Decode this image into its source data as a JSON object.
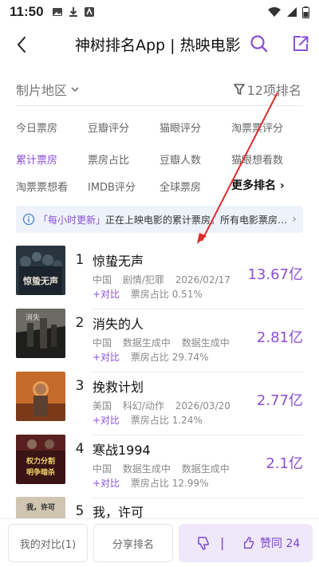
{
  "status_bar": {
    "time": "11:50"
  },
  "header": {
    "title": "神树排名App | 热映电影"
  },
  "filters": {
    "region": "制片地区",
    "rank_count": "12项排名"
  },
  "tabs": [
    {
      "label": "今日票房"
    },
    {
      "label": "豆瓣评分"
    },
    {
      "label": "猫眼评分"
    },
    {
      "label": "淘票票评分"
    },
    {
      "label": "累计票房",
      "active": true
    },
    {
      "label": "票房占比"
    },
    {
      "label": "豆瓣人数"
    },
    {
      "label": "猫眼想看数"
    },
    {
      "label": "淘票票想看"
    },
    {
      "label": "IMDB评分"
    },
    {
      "label": "全球票房"
    },
    {
      "label": "更多排名"
    }
  ],
  "notice": {
    "highlight": "「每小时更新」",
    "text": "正在上映电影的累计票房。所有电影票房…"
  },
  "movies": [
    {
      "rank": "1",
      "title": "惊蛰无声",
      "country": "中国",
      "genre": "剧情/犯罪",
      "date": "2026/02/17",
      "compare": "+对比",
      "share_label": "票房占比",
      "share": "0.51%",
      "value": "13.67亿"
    },
    {
      "rank": "2",
      "title": "消失的人",
      "country": "中国",
      "genre": "数据生成中",
      "date": "数据生成中",
      "compare": "+对比",
      "share_label": "票房占比",
      "share": "29.74%",
      "value": "2.81亿"
    },
    {
      "rank": "3",
      "title": "挽救计划",
      "country": "美国",
      "genre": "科幻/动作",
      "date": "2026/03/20",
      "compare": "+对比",
      "share_label": "票房占比",
      "share": "1.24%",
      "value": "2.77亿"
    },
    {
      "rank": "4",
      "title": "寒战1994",
      "country": "中国",
      "genre": "数据生成中",
      "date": "数据生成中",
      "compare": "+对比",
      "share_label": "票房占比",
      "share": "12.99%",
      "value": "2.1亿"
    },
    {
      "rank": "5",
      "title": "我，许可"
    }
  ],
  "bottom": {
    "my_compare": "我的对比(1)",
    "share_rank": "分享排名",
    "vote_up": "赞同 24"
  },
  "posters": {
    "poster1_text": "惊蛰无声",
    "poster4_text": "权力分割 明争暗杀",
    "poster5_text": "我，许可"
  }
}
